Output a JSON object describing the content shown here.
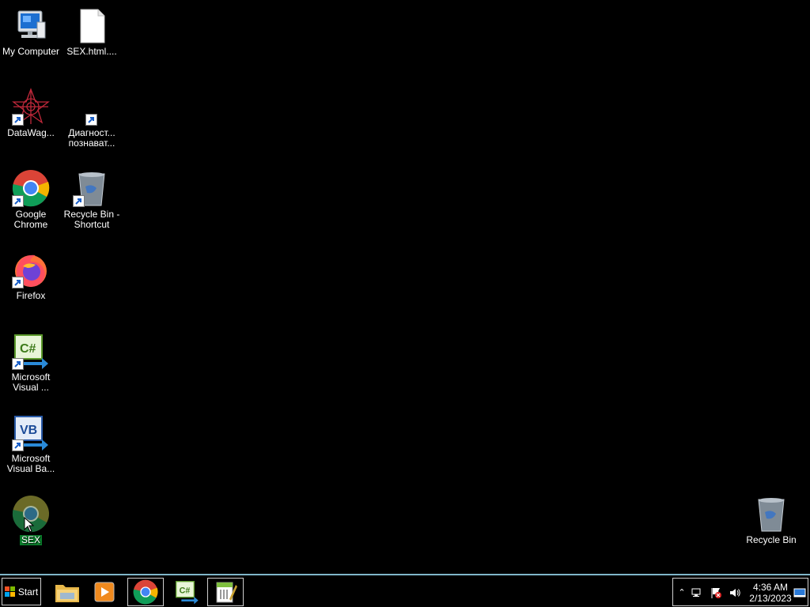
{
  "desktop": {
    "icons": [
      {
        "label": "My Computer",
        "icon": "computer-icon"
      },
      {
        "label": "SEX.html....",
        "icon": "file-icon"
      },
      {
        "label": "DataWag...",
        "icon": "datawag-icon"
      },
      {
        "label": "Диагност... познават...",
        "icon": "blank-shortcut-icon"
      },
      {
        "label": "Google Chrome",
        "icon": "chrome-icon"
      },
      {
        "label": "Recycle Bin - Shortcut",
        "icon": "recycle-bin-icon"
      },
      {
        "label": "Firefox",
        "icon": "firefox-icon"
      },
      {
        "label": "Microsoft Visual ...",
        "icon": "visual-csharp-icon"
      },
      {
        "label": "Microsoft Visual Ba...",
        "icon": "visual-basic-icon"
      },
      {
        "label": "SEX",
        "icon": "chrome-icon"
      },
      {
        "label": "Recycle Bin",
        "icon": "recycle-bin-icon"
      }
    ]
  },
  "taskbar": {
    "start_label": "Start",
    "pinned": [
      {
        "name": "file-explorer-icon"
      },
      {
        "name": "media-player-icon"
      },
      {
        "name": "chrome-icon"
      },
      {
        "name": "visual-csharp-icon"
      },
      {
        "name": "notepad-plus-icon"
      }
    ],
    "clock": {
      "time": "4:36 AM",
      "date": "2/13/2023"
    }
  },
  "colors": {
    "accent": "#7fb5c9",
    "selection": "#0a7a2a"
  }
}
